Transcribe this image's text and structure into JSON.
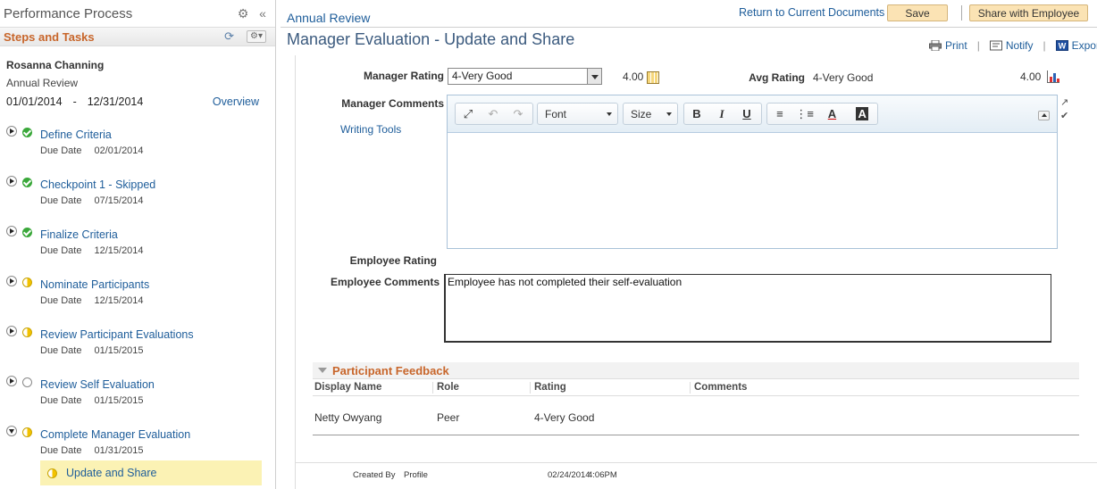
{
  "left_panel": {
    "title": "Performance Process",
    "steps_title": "Steps and Tasks",
    "employee": {
      "name": "Rosanna Channing",
      "document": "Annual Review",
      "start_date": "01/01/2014",
      "dash": "-",
      "end_date": "12/31/2014",
      "overview_label": "Overview"
    },
    "due_label": "Due Date",
    "steps": [
      {
        "label": "Define Criteria",
        "due": "02/01/2014",
        "status": "complete"
      },
      {
        "label": "Checkpoint 1 - Skipped",
        "due": "07/15/2014",
        "status": "complete"
      },
      {
        "label": "Finalize Criteria",
        "due": "12/15/2014",
        "status": "complete"
      },
      {
        "label": "Nominate Participants",
        "due": "12/15/2014",
        "status": "in-progress"
      },
      {
        "label": "Review Participant Evaluations",
        "due": "01/15/2015",
        "status": "in-progress"
      },
      {
        "label": "Review Self Evaluation",
        "due": "01/15/2015",
        "status": "not-started"
      },
      {
        "label": "Complete Manager Evaluation",
        "due": "01/31/2015",
        "status": "in-progress"
      }
    ],
    "substep": {
      "label": "Update and Share",
      "status": "in-progress"
    }
  },
  "header": {
    "breadcrumb": "Annual Review",
    "return_link": "Return to Current Documents",
    "save_label": "Save",
    "share_label": "Share with Employee",
    "page_title": "Manager Evaluation - Update and Share",
    "print_label": "Print",
    "notify_label": "Notify",
    "export_label": "Export"
  },
  "form": {
    "manager_rating_label": "Manager Rating",
    "manager_rating_value": "4-Very Good",
    "manager_rating_score": "4.00",
    "avg_rating_label": "Avg Rating",
    "avg_rating_value": "4-Very Good",
    "avg_rating_score": "4.00",
    "manager_comments_label": "Manager Comments",
    "writing_tools_label": "Writing Tools",
    "font_label": "Font",
    "size_label": "Size",
    "bold": "B",
    "italic": "I",
    "underline": "U",
    "text_color": "A",
    "bg_color": "A",
    "employee_rating_label": "Employee Rating",
    "employee_comments_label": "Employee Comments",
    "employee_comments_value": "Employee has not completed their self-evaluation"
  },
  "participant_feedback": {
    "title": "Participant Feedback",
    "columns": [
      "Display Name",
      "Role",
      "Rating",
      "Comments"
    ],
    "rows": [
      {
        "name": "Netty Owyang",
        "role": "Peer",
        "rating": "4-Very Good",
        "comments": ""
      }
    ]
  },
  "footer": {
    "created_by_label": "Created By",
    "created_by_value": "Profile",
    "created_date": "02/24/2014",
    "created_time": "4:06PM"
  },
  "colors": {
    "accent_orange": "#c8662b",
    "link_blue": "#1e5d9a",
    "button_bg": "#fbe3b4",
    "highlight": "#fbf2b4",
    "complete_green": "#3aa83a",
    "progress_yellow": "#f3c200"
  }
}
